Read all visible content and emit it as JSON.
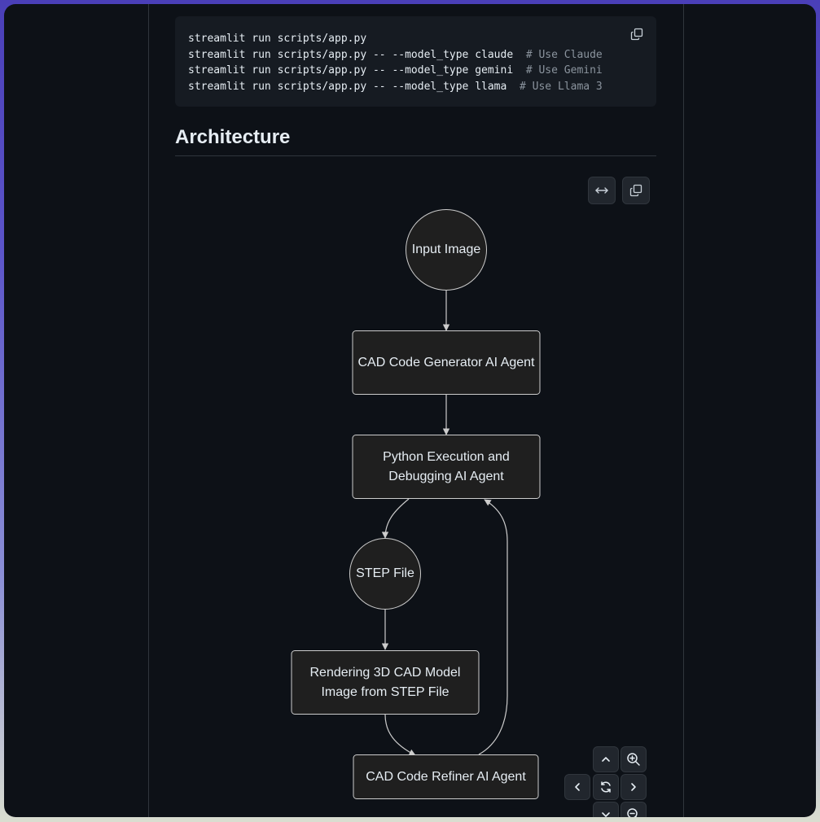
{
  "code": {
    "lines": [
      {
        "cmd": "streamlit run scripts/app.py",
        "comment": ""
      },
      {
        "cmd": "streamlit run scripts/app.py -- --model_type claude  ",
        "comment": "# Use Claude"
      },
      {
        "cmd": "streamlit run scripts/app.py -- --model_type gemini  ",
        "comment": "# Use Gemini"
      },
      {
        "cmd": "streamlit run scripts/app.py -- --model_type llama  ",
        "comment": "# Use Llama 3"
      }
    ],
    "copy_icon": "copy-icon"
  },
  "section": {
    "title": "Architecture"
  },
  "diagram": {
    "nodes": {
      "input_image": "Input Image",
      "cad_generator": "CAD Code Generator AI Agent",
      "python_exec": "Python Execution and Debugging AI Agent",
      "step_file": "STEP File",
      "rendering": "Rendering 3D CAD Model Image from STEP File",
      "refiner": "CAD Code Refiner AI Agent"
    },
    "colors": {
      "node_fill": "#1f1f1f",
      "node_stroke": "#cccccc",
      "edge": "#cccccc",
      "background": "#0d1117"
    }
  },
  "toolbar": {
    "expand_icon": "expand-horizontal-icon",
    "copy_icon": "copy-icon"
  },
  "controls": {
    "up": "chevron-up-icon",
    "zoom_in": "zoom-in-icon",
    "left": "chevron-left-icon",
    "reset": "reset-icon",
    "right": "chevron-right-icon",
    "down": "chevron-down-icon",
    "zoom_out": "zoom-out-icon"
  }
}
